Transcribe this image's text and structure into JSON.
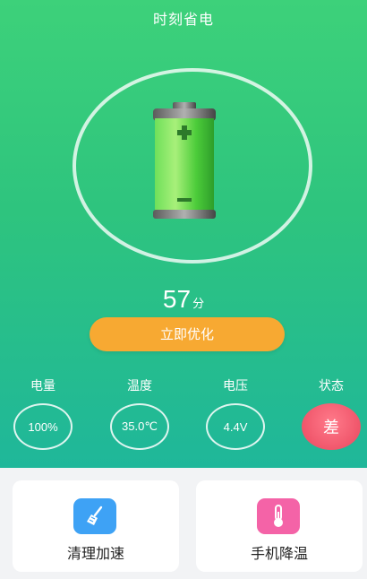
{
  "app": {
    "title": "时刻省电"
  },
  "score": {
    "value": "57",
    "unit": "分"
  },
  "optimize": {
    "label": "立即优化"
  },
  "stats": [
    {
      "label": "电量",
      "value": "100%"
    },
    {
      "label": "温度",
      "value": "35.0℃"
    },
    {
      "label": "电压",
      "value": "4.4V"
    },
    {
      "label": "状态",
      "value": "差"
    }
  ],
  "tools": [
    {
      "label": "清理加速",
      "icon": "broom-icon",
      "color": "#3ea2f5"
    },
    {
      "label": "手机降温",
      "icon": "thermometer-icon",
      "color": "#f463a7"
    }
  ],
  "colors": {
    "accent": "#f7a932",
    "bad": "#f0566b",
    "bg_top": "#3dd17a",
    "bg_bottom": "#1fb79a"
  }
}
